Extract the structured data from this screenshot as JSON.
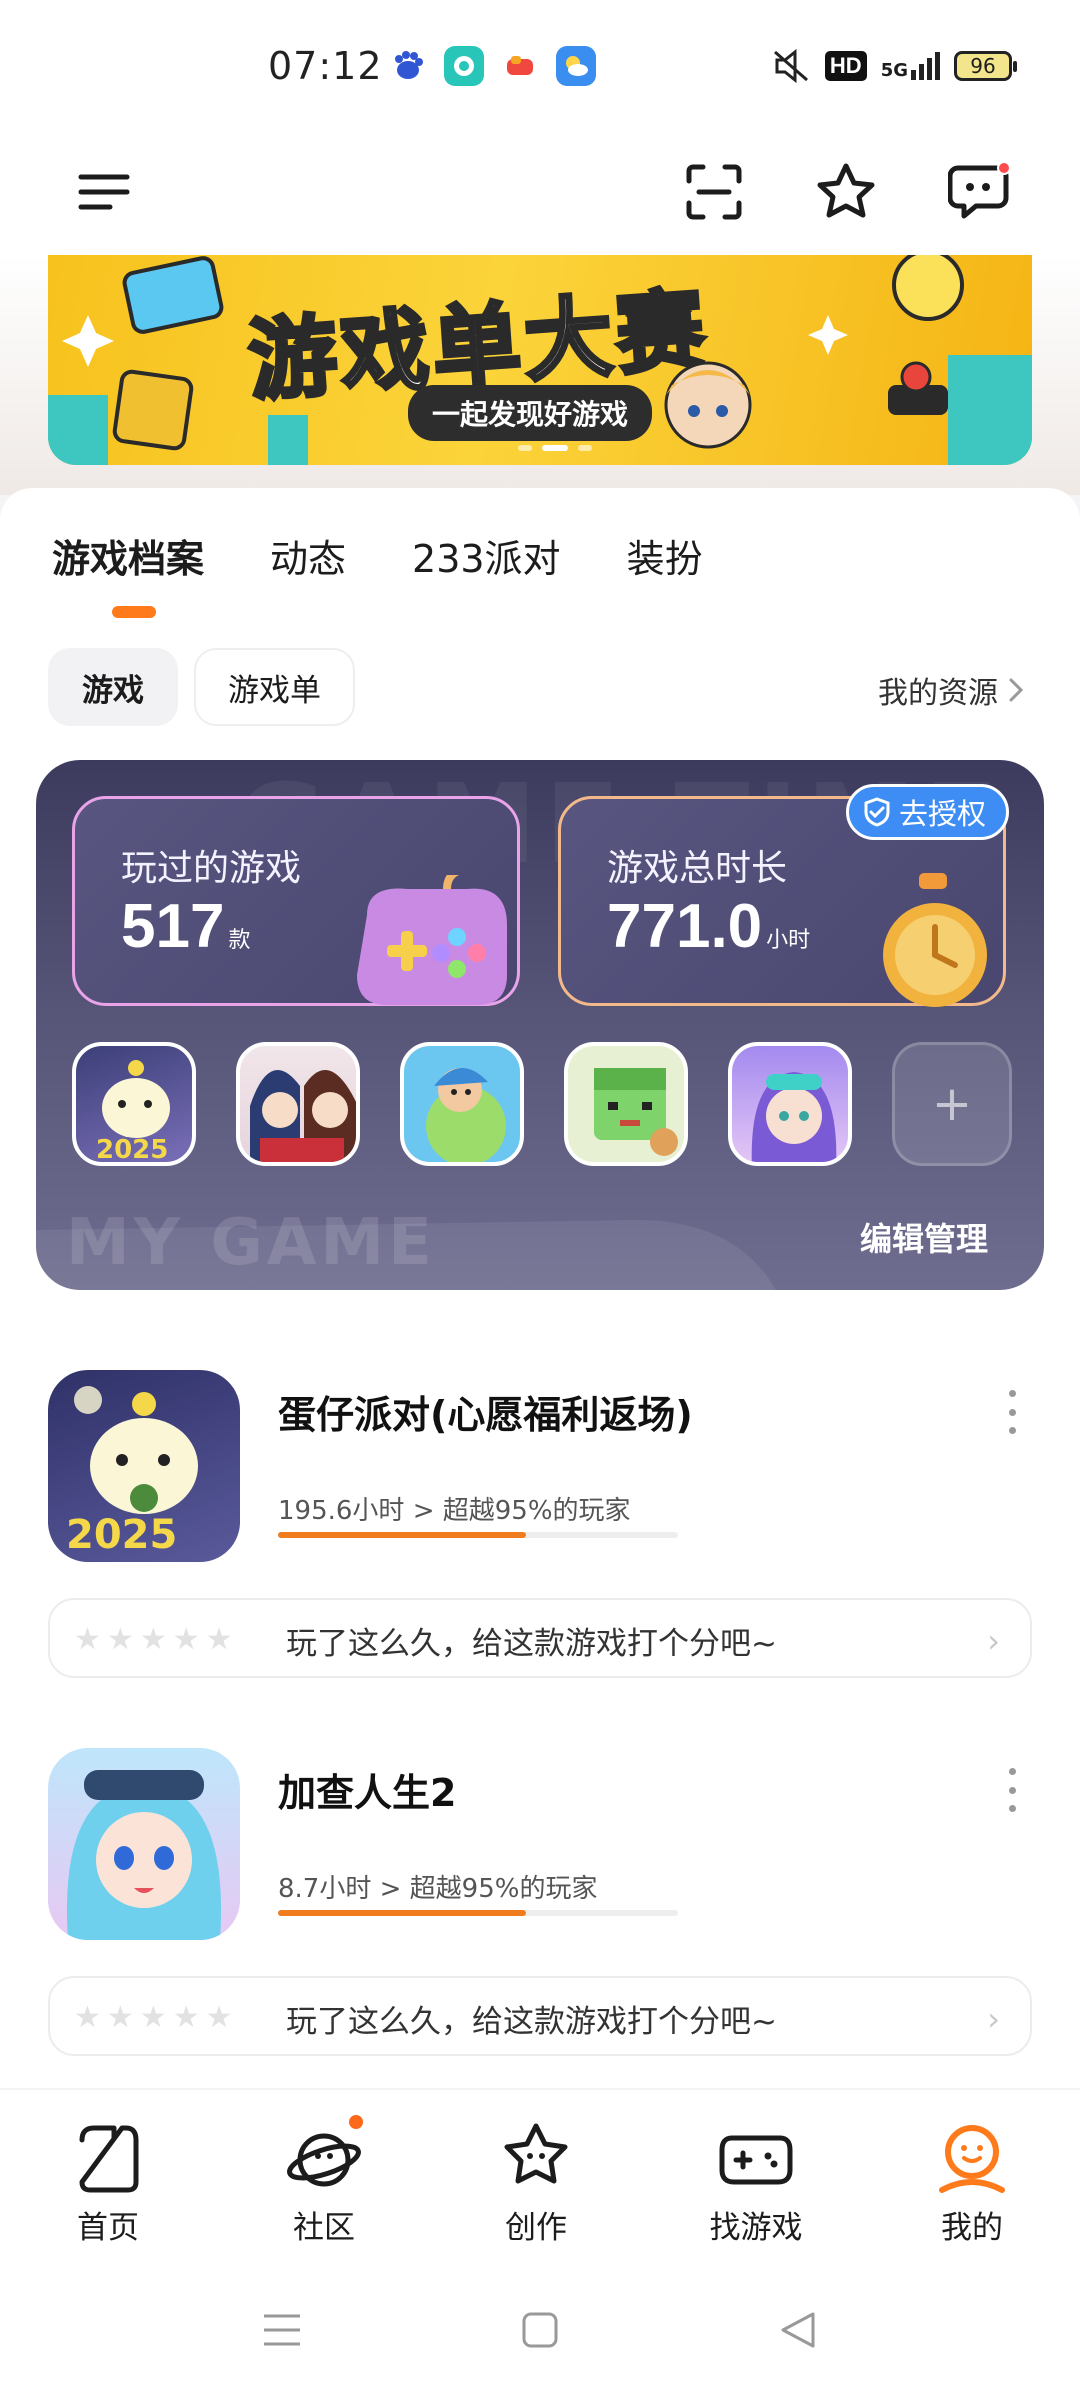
{
  "status_bar": {
    "time": "07:12",
    "network_label": "5G",
    "hd_label": "HD",
    "battery": "96"
  },
  "banner": {
    "title": "游戏单大赛",
    "subtitle": "一起发现好游戏"
  },
  "tabs": [
    {
      "label": "游戏档案",
      "active": true
    },
    {
      "label": "动态",
      "active": false
    },
    {
      "label": "233派对",
      "active": false
    },
    {
      "label": "装扮",
      "active": false
    }
  ],
  "chips": [
    {
      "label": "游戏",
      "active": true
    },
    {
      "label": "游戏单",
      "active": false
    }
  ],
  "my_resources": "我的资源",
  "game_card": {
    "watermark_top": "GAME TIME",
    "watermark_bottom": "MY GAME",
    "played": {
      "label": "玩过的游戏",
      "value": "517",
      "unit": "款"
    },
    "total_time": {
      "label": "游戏总时长",
      "value": "771.0",
      "unit": "小时"
    },
    "authorize": "去授权",
    "add": "+",
    "edit_manage": "编辑管理"
  },
  "game_list": [
    {
      "title": "蛋仔派对(心愿福利返场)",
      "hours": "195.6小时 > 超越95%的玩家",
      "progress": 0.62,
      "rate_prompt": "玩了这么久，给这款游戏打个分吧~"
    },
    {
      "title": "加查人生2",
      "hours": "8.7小时 > 超越95%的玩家",
      "progress": 0.62,
      "rate_prompt": "玩了这么久，给这款游戏打个分吧~"
    }
  ],
  "bottom_nav": [
    {
      "label": "首页",
      "icon": "home-icon",
      "active": false
    },
    {
      "label": "社区",
      "icon": "community-planet-icon",
      "active": false,
      "dot": true
    },
    {
      "label": "创作",
      "icon": "create-star-icon",
      "active": false
    },
    {
      "label": "找游戏",
      "icon": "gamepad-icon",
      "active": false
    },
    {
      "label": "我的",
      "icon": "profile-icon",
      "active": true
    }
  ],
  "colors": {
    "accent": "#ff7a1a",
    "card_bg": "#4b4a6e",
    "authorize_blue": "#3d8df5"
  }
}
